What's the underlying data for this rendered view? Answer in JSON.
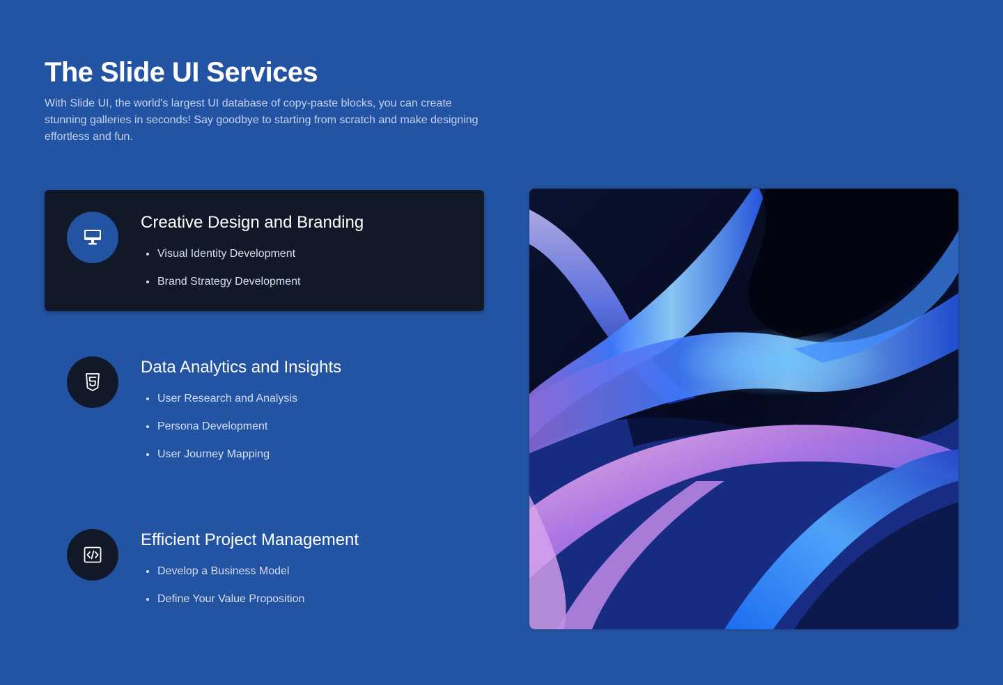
{
  "header": {
    "title": "The Slide UI Services",
    "description": "With Slide UI, the world's largest UI database of copy-paste blocks, you can create stunning galleries in seconds! Say goodbye to starting from scratch and make designing effortless and fun."
  },
  "services": [
    {
      "title": "Creative Design and Branding",
      "icon": "monitor-icon",
      "active": true,
      "items": [
        "Visual Identity Development",
        "Brand Strategy Development"
      ]
    },
    {
      "title": "Data Analytics and Insights",
      "icon": "html5-icon",
      "active": false,
      "items": [
        "User Research and Analysis",
        "Persona Development",
        "User Journey Mapping"
      ]
    },
    {
      "title": "Efficient Project Management",
      "icon": "code-icon",
      "active": false,
      "items": [
        "Develop a Business Model",
        "Define Your Value Proposition"
      ]
    }
  ],
  "hero_image": {
    "description_icon": "abstract-wave-image"
  },
  "colors": {
    "background": "#2353a3",
    "card_active": "#111827",
    "icon_dark": "#111827",
    "text_primary": "#ffffff",
    "text_secondary": "#d5dff3"
  }
}
